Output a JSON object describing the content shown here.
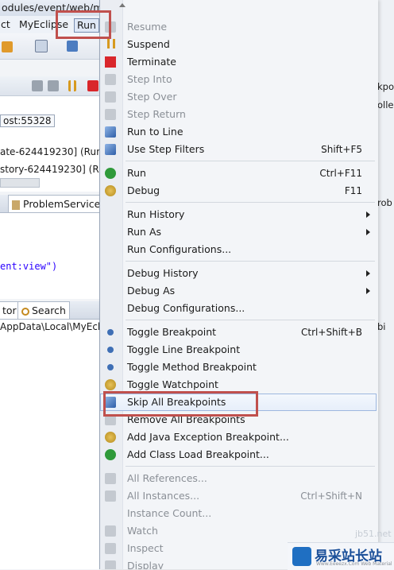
{
  "ide": {
    "title_fragment": "odules/event/web/ma",
    "menu": {
      "project_fragment": "ct",
      "myeclipse": "MyEclipse",
      "run": "Run"
    },
    "debug_lines": {
      "host": "ost:55328",
      "thread1": "ate-624419230] (Runn",
      "thread2": "story-624419230] (Runn"
    },
    "editor_tab": "ProblemService",
    "code_line": "ent:view\")",
    "bottom_tabs": {
      "left_fragment": "tor",
      "search": "Search"
    },
    "path_fragment": "AppData\\Local\\MyEcli",
    "right_fragments": {
      "r1": "kpo",
      "r2": "olle",
      "r3": "rob",
      "r4": "bi"
    }
  },
  "menu": {
    "groups": [
      [
        {
          "label": "Resume",
          "shortcut": "",
          "disabled": true,
          "icon": "resume-icon"
        },
        {
          "label": "Suspend",
          "shortcut": "",
          "disabled": false,
          "icon": "suspend-icon"
        },
        {
          "label": "Terminate",
          "shortcut": "",
          "disabled": false,
          "icon": "terminate-icon"
        },
        {
          "label": "Step Into",
          "shortcut": "",
          "disabled": true,
          "icon": "step-into-icon"
        },
        {
          "label": "Step Over",
          "shortcut": "",
          "disabled": true,
          "icon": "step-over-icon"
        },
        {
          "label": "Step Return",
          "shortcut": "",
          "disabled": true,
          "icon": "step-return-icon"
        },
        {
          "label": "Run to Line",
          "shortcut": "",
          "disabled": false,
          "icon": "run-to-line-icon"
        },
        {
          "label": "Use Step Filters",
          "shortcut": "Shift+F5",
          "disabled": false,
          "icon": "step-filters-icon"
        }
      ],
      [
        {
          "label": "Run",
          "shortcut": "Ctrl+F11",
          "disabled": false,
          "icon": "run-icon"
        },
        {
          "label": "Debug",
          "shortcut": "F11",
          "disabled": false,
          "icon": "debug-icon"
        }
      ],
      [
        {
          "label": "Run History",
          "shortcut": "",
          "submenu": true
        },
        {
          "label": "Run As",
          "shortcut": "",
          "submenu": true
        },
        {
          "label": "Run Configurations...",
          "shortcut": ""
        }
      ],
      [
        {
          "label": "Debug History",
          "shortcut": "",
          "submenu": true
        },
        {
          "label": "Debug As",
          "shortcut": "",
          "submenu": true
        },
        {
          "label": "Debug Configurations...",
          "shortcut": ""
        }
      ],
      [
        {
          "label": "Toggle Breakpoint",
          "shortcut": "Ctrl+Shift+B",
          "icon": "toggle-breakpoint-icon"
        },
        {
          "label": "Toggle Line Breakpoint",
          "shortcut": "",
          "icon": "line-breakpoint-icon"
        },
        {
          "label": "Toggle Method Breakpoint",
          "shortcut": "",
          "icon": "method-breakpoint-icon"
        },
        {
          "label": "Toggle Watchpoint",
          "shortcut": "",
          "icon": "watchpoint-icon"
        },
        {
          "label": "Skip All Breakpoints",
          "shortcut": "",
          "icon": "skip-breakpoints-icon",
          "highlight": true
        },
        {
          "label": "Remove All Breakpoints",
          "shortcut": "",
          "icon": "remove-breakpoints-icon"
        },
        {
          "label": "Add Java Exception Breakpoint...",
          "shortcut": "",
          "icon": "exception-breakpoint-icon"
        },
        {
          "label": "Add Class Load Breakpoint...",
          "shortcut": "",
          "icon": "class-load-breakpoint-icon"
        }
      ],
      [
        {
          "label": "All References...",
          "shortcut": "",
          "disabled": true,
          "icon": "references-icon"
        },
        {
          "label": "All Instances...",
          "shortcut": "Ctrl+Shift+N",
          "disabled": true,
          "icon": "instances-icon"
        },
        {
          "label": "Instance Count...",
          "shortcut": "",
          "disabled": true
        },
        {
          "label": "Watch",
          "shortcut": "",
          "disabled": true,
          "icon": "watch-icon"
        },
        {
          "label": "Inspect",
          "shortcut": "",
          "disabled": true,
          "icon": "inspect-icon"
        },
        {
          "label": "Display",
          "shortcut": "",
          "disabled": true,
          "icon": "display-icon"
        }
      ]
    ]
  },
  "watermark": {
    "brand": "易采站长站",
    "sub": "Www.Eeeezx.Com  Web Material",
    "site_fragment": "jb51.net"
  },
  "colors": {
    "highlight_box": "#c0504d",
    "accent": "#3f6fb5"
  }
}
